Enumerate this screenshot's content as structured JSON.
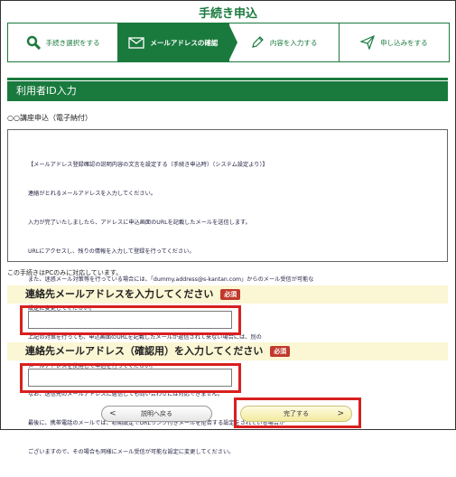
{
  "page": {
    "title": "手続き申込"
  },
  "steps": [
    {
      "label": "手続き選択をする",
      "icon": "search-icon"
    },
    {
      "label": "メールアドレスの確認",
      "icon": "mail-icon",
      "active": true
    },
    {
      "label": "内容を入力する",
      "icon": "pencil-icon"
    },
    {
      "label": "申し込みをする",
      "icon": "send-icon"
    }
  ],
  "section": {
    "title": "利用者ID入力"
  },
  "procedure": {
    "name": "○○講座申込（電子納付）"
  },
  "info": {
    "lines": [
      "【メールアドレス登録確認の説明内容の文言を設定する（手続き申込時）（システム設定より）】",
      "連絡がとれるメールアドレスを入力してください。",
      "入力が完了いたしましたら、アドレスに申込画面のURLを記載したメールを送信します。",
      "URLにアクセスし、残りの情報を入力して登録を行ってください。",
      "また、迷惑メール対策等を行っている場合には、「dummy.address@s-kantan.com」からのメール受信が可能な",
      "設定に変更してください。",
      "上記の対策を行っても、申込画面のURLを記載したメールが返信されて来ない場合には、別の",
      "メールアドレスを使用して申込を行ってください。",
      "なお、送信元のメールアドレスに返信しても問い合わせには対応できません。",
      "最後に、携帯電話のメールでは、初期設定でURLリンク付きメールを拒否する設定をされている場合が",
      "ございますので、その場合も同様にメール受信が可能な設定に変更してください。"
    ]
  },
  "pc_note": "この手続きはPCのみに対応しています。",
  "fields": {
    "email": {
      "label": "連絡先メールアドレスを入力してください",
      "required": "必須",
      "value": ""
    },
    "email_confirm": {
      "label": "連絡先メールアドレス（確認用）を入力してください",
      "required": "必須",
      "value": ""
    }
  },
  "buttons": {
    "back": "説明へ戻る",
    "done": "完了する"
  },
  "colors": {
    "brand_green": "#1a7a3e",
    "highlight_red": "#d8201f",
    "required_badge": "#c0392b",
    "label_bg": "#fbf6d4"
  }
}
